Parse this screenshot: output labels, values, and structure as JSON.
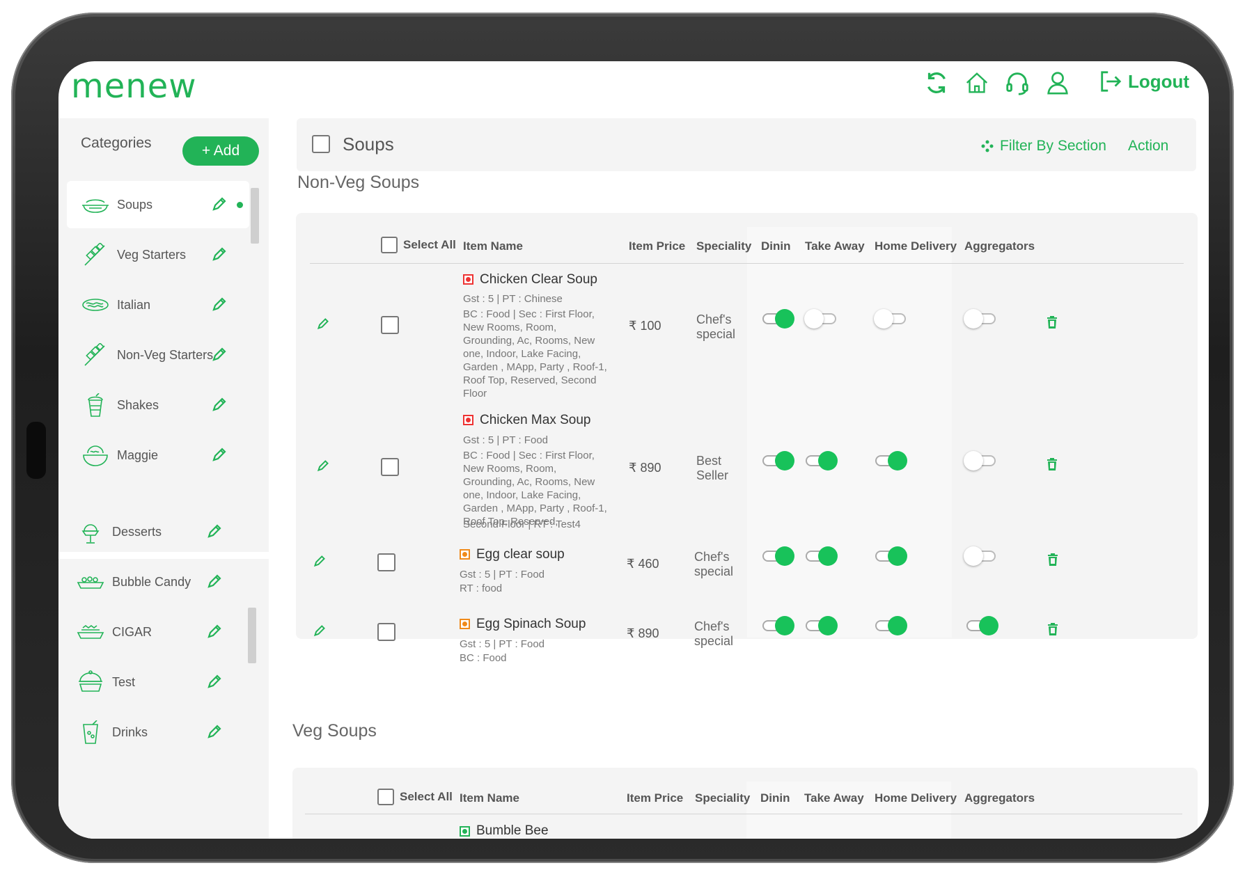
{
  "brand": {
    "logo": "menew",
    "accent": "#22b357"
  },
  "topbar": {
    "icons": [
      "refresh-icon",
      "home-icon",
      "headset-icon",
      "user-icon"
    ],
    "logout_label": "Logout"
  },
  "sidebar": {
    "title": "Categories",
    "add_label": "+ Add",
    "categories": [
      {
        "label": "Soups",
        "icon": "soup-bowl-icon",
        "active": true
      },
      {
        "label": "Veg Starters",
        "icon": "skewer-icon"
      },
      {
        "label": "Italian",
        "icon": "pasta-plate-icon"
      },
      {
        "label": "Non-Veg Starters",
        "icon": "skewer-icon"
      },
      {
        "label": "Shakes",
        "icon": "milkshake-icon"
      },
      {
        "label": "Maggie",
        "icon": "noodle-bowl-icon"
      },
      {
        "label": "Desserts",
        "icon": "ice-cream-icon"
      },
      {
        "label": "Bubble Candy",
        "icon": "candy-tray-icon"
      },
      {
        "label": "CIGAR",
        "icon": "cigar-tray-icon"
      },
      {
        "label": "Test",
        "icon": "covered-dish-icon"
      },
      {
        "label": "Drinks",
        "icon": "drink-cup-icon"
      }
    ]
  },
  "main": {
    "header": {
      "title": "Soups",
      "filter_label": "Filter By Section",
      "action_label": "Action"
    },
    "columns": {
      "select_all": "Select All",
      "item_name": "Item Name",
      "item_price": "Item Price",
      "speciality": "Speciality",
      "dinin": "Dinin",
      "take_away": "Take Away",
      "home_delivery": "Home Delivery",
      "aggregators": "Aggregators"
    },
    "sections": [
      {
        "title": "Non-Veg Soups",
        "items": [
          {
            "name": "Chicken Clear Soup",
            "type": "non-veg",
            "meta1": "Gst : 5 | PT : Chinese",
            "meta2": "BC : Food | Sec : First Floor, New Rooms, Room, Grounding, Ac, Rooms, New one, Indoor, Lake Facing, Garden , MApp, Party , Roof-1, Roof Top, Reserved, Second Floor",
            "price": "₹ 100",
            "speciality": "Chef's special",
            "dinin": true,
            "take_away": false,
            "home_delivery": false,
            "aggregators": false
          },
          {
            "name": "Chicken Max Soup",
            "type": "non-veg",
            "meta1": "Gst : 5 | PT : Food",
            "meta2": "BC : Food | Sec : First Floor, New Rooms, Room, Grounding, Ac, Rooms, New one, Indoor, Lake Facing, Garden , MApp, Party , Roof-1, Roof Top, Reserved,",
            "meta3": "Second Floor | RT : Test4",
            "price": "₹ 890",
            "speciality": "Best Seller",
            "dinin": true,
            "take_away": true,
            "home_delivery": true,
            "aggregators": false
          },
          {
            "name": "Egg clear soup",
            "type": "egg",
            "meta1": "Gst : 5 | PT : Food",
            "meta2": "RT : food",
            "price": "₹ 460",
            "speciality": "Chef's special",
            "dinin": true,
            "take_away": true,
            "home_delivery": true,
            "aggregators": false
          },
          {
            "name": "Egg Spinach Soup",
            "type": "egg",
            "meta1": "Gst : 5 | PT : Food",
            "meta2": "BC : Food",
            "price": "₹ 890",
            "speciality": "Chef's special",
            "dinin": true,
            "take_away": true,
            "home_delivery": true,
            "aggregators": true
          }
        ]
      },
      {
        "title": "Veg Soups",
        "items": [
          {
            "name": "Bumble Bee",
            "type": "veg"
          }
        ]
      }
    ]
  }
}
